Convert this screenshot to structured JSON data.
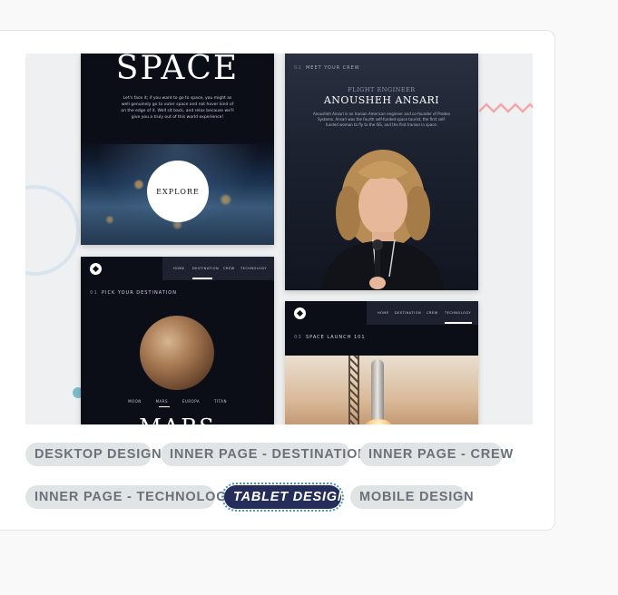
{
  "preview": {
    "home": {
      "title": "SPACE",
      "text": "Let's face it; if you want to go to space, you might as well genuinely go to outer space and not hover kind of on the edge of it. Well sit back, and relax because we'll give you a truly out of this world experience!",
      "explore": "EXPLORE"
    },
    "crew": {
      "heading_num": "02",
      "heading": "MEET YOUR CREW",
      "role": "FLIGHT ENGINEER",
      "name": "ANOUSHEH ANSARI",
      "bio": "Anousheh Ansari is an Iranian American engineer and co-founder of Prodea Systems. Ansari was the fourth self-funded space tourist, the first self-funded woman to fly to the ISS, and the first Iranian in space."
    },
    "destination": {
      "nav": [
        "HOME",
        "DESTINATION",
        "CREW",
        "TECHNOLOGY"
      ],
      "heading_num": "01",
      "heading": "PICK YOUR DESTINATION",
      "tabs": [
        "MOON",
        "MARS",
        "EUROPA",
        "TITAN"
      ],
      "planet": "MARS"
    },
    "technology": {
      "nav": [
        "HOME",
        "DESTINATION",
        "CREW",
        "TECHNOLOGY"
      ],
      "heading_num": "03",
      "heading": "SPACE LAUNCH 101"
    }
  },
  "tags": [
    {
      "label": "DESKTOP DESIGN",
      "active": false
    },
    {
      "label": "INNER PAGE - DESTINATION",
      "active": false
    },
    {
      "label": "INNER PAGE - CREW",
      "active": false
    },
    {
      "label": "INNER PAGE - TECHNOLOGY",
      "active": false
    },
    {
      "label": "TABLET DESIGN",
      "active": true
    },
    {
      "label": "MOBILE DESIGN",
      "active": false
    }
  ],
  "colors": {
    "page_bg": "#f9f9f9",
    "tag_bg": "#e0e4e5",
    "tag_text": "#6a7178",
    "active_tag_bg": "#252d5a",
    "active_tag_outline": "#4a90c8",
    "space_dark": "#0b0d17",
    "decoration_zigzag": "#f4a8a8"
  }
}
